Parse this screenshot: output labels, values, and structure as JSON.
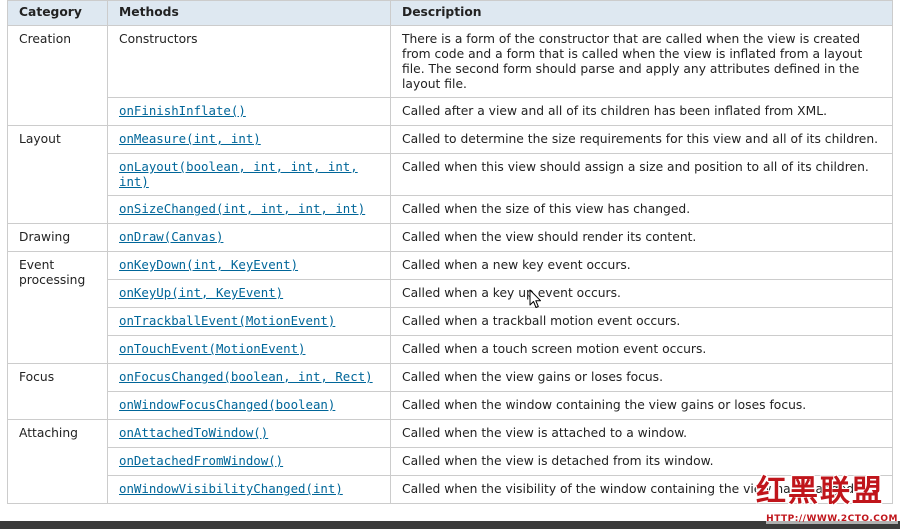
{
  "table": {
    "headers": {
      "category": "Category",
      "methods": "Methods",
      "description": "Description"
    },
    "groups": [
      {
        "category": "Creation",
        "rows": [
          {
            "method": "Constructors",
            "link": false,
            "description": "There is a form of the constructor that are called when the view is created from code and a form that is called when the view is inflated from a layout file. The second form should parse and apply any attributes defined in the layout file."
          },
          {
            "method": "onFinishInflate()",
            "link": true,
            "description": "Called after a view and all of its children has been inflated from XML."
          }
        ]
      },
      {
        "category": "Layout",
        "rows": [
          {
            "method": "onMeasure(int, int)",
            "link": true,
            "description": "Called to determine the size requirements for this view and all of its children."
          },
          {
            "method": "onLayout(boolean, int, int, int, int)",
            "link": true,
            "description": "Called when this view should assign a size and position to all of its children."
          },
          {
            "method": "onSizeChanged(int, int, int, int)",
            "link": true,
            "description": "Called when the size of this view has changed."
          }
        ]
      },
      {
        "category": "Drawing",
        "rows": [
          {
            "method": "onDraw(Canvas)",
            "link": true,
            "description": "Called when the view should render its content."
          }
        ]
      },
      {
        "category": "Event processing",
        "rows": [
          {
            "method": "onKeyDown(int, KeyEvent)",
            "link": true,
            "description": "Called when a new key event occurs."
          },
          {
            "method": "onKeyUp(int, KeyEvent)",
            "link": true,
            "description": "Called when a key up event occurs."
          },
          {
            "method": "onTrackballEvent(MotionEvent)",
            "link": true,
            "description": "Called when a trackball motion event occurs."
          },
          {
            "method": "onTouchEvent(MotionEvent)",
            "link": true,
            "description": "Called when a touch screen motion event occurs."
          }
        ]
      },
      {
        "category": "Focus",
        "rows": [
          {
            "method": "onFocusChanged(boolean, int, Rect)",
            "link": true,
            "description": "Called when the view gains or loses focus."
          },
          {
            "method": "onWindowFocusChanged(boolean)",
            "link": true,
            "description": "Called when the window containing the view gains or loses focus."
          }
        ]
      },
      {
        "category": "Attaching",
        "rows": [
          {
            "method": "onAttachedToWindow()",
            "link": true,
            "description": "Called when the view is attached to a window."
          },
          {
            "method": "onDetachedFromWindow()",
            "link": true,
            "description": "Called when the view is detached from its window."
          },
          {
            "method": "onWindowVisibilityChanged(int)",
            "link": true,
            "description": "Called when the visibility of the window containing the view has changed."
          }
        ]
      }
    ]
  },
  "watermark": {
    "logo_text": "红黑联盟",
    "url_text": "HTTP://WWW.2CTO.COM"
  },
  "colors": {
    "header_bg": "#dee8f1",
    "link": "#006699",
    "border": "#cccccc",
    "watermark": "#c0151b"
  },
  "icons": {
    "cursor": "mouse-pointer-icon"
  }
}
